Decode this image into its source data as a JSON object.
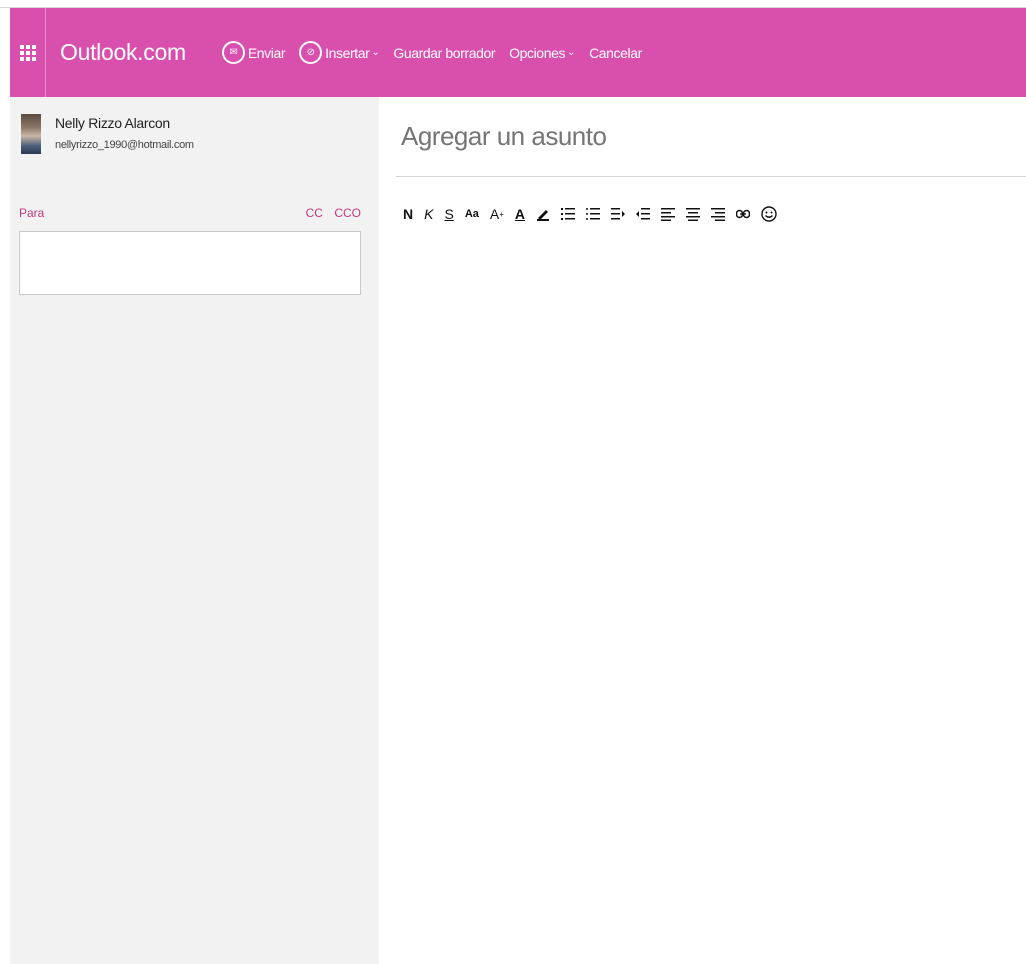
{
  "appbar": {
    "brand": "Outlook.com",
    "commands": {
      "send": "Enviar",
      "insert": "Insertar",
      "save_draft": "Guardar borrador",
      "options": "Opciones",
      "cancel": "Cancelar"
    },
    "color": "#d94fae"
  },
  "sender": {
    "name": "Nelly Rizzo Alarcon",
    "email": "nellyrizzo_1990@hotmail.com"
  },
  "recipients": {
    "to_label": "Para",
    "cc_label": "CC",
    "bcc_label": "CCO",
    "to_value": ""
  },
  "subject": {
    "placeholder": "Agregar un asunto",
    "value": ""
  },
  "toolbar": {
    "bold": "N",
    "italic": "K",
    "underline": "S",
    "font_size": "Aa",
    "grow_font": "A",
    "font_color": "A",
    "icons": [
      "bold-icon",
      "italic-icon",
      "underline-icon",
      "font-size-icon",
      "grow-font-icon",
      "font-color-icon",
      "highlight-icon",
      "numbered-list-icon",
      "bulleted-list-icon",
      "decrease-indent-icon",
      "increase-indent-icon",
      "align-left-icon",
      "align-center-icon",
      "align-right-icon",
      "link-icon",
      "emoji-icon"
    ]
  },
  "colors": {
    "accent": "#d94fae",
    "link": "#c2397f",
    "pane": "#f2f2f2"
  }
}
